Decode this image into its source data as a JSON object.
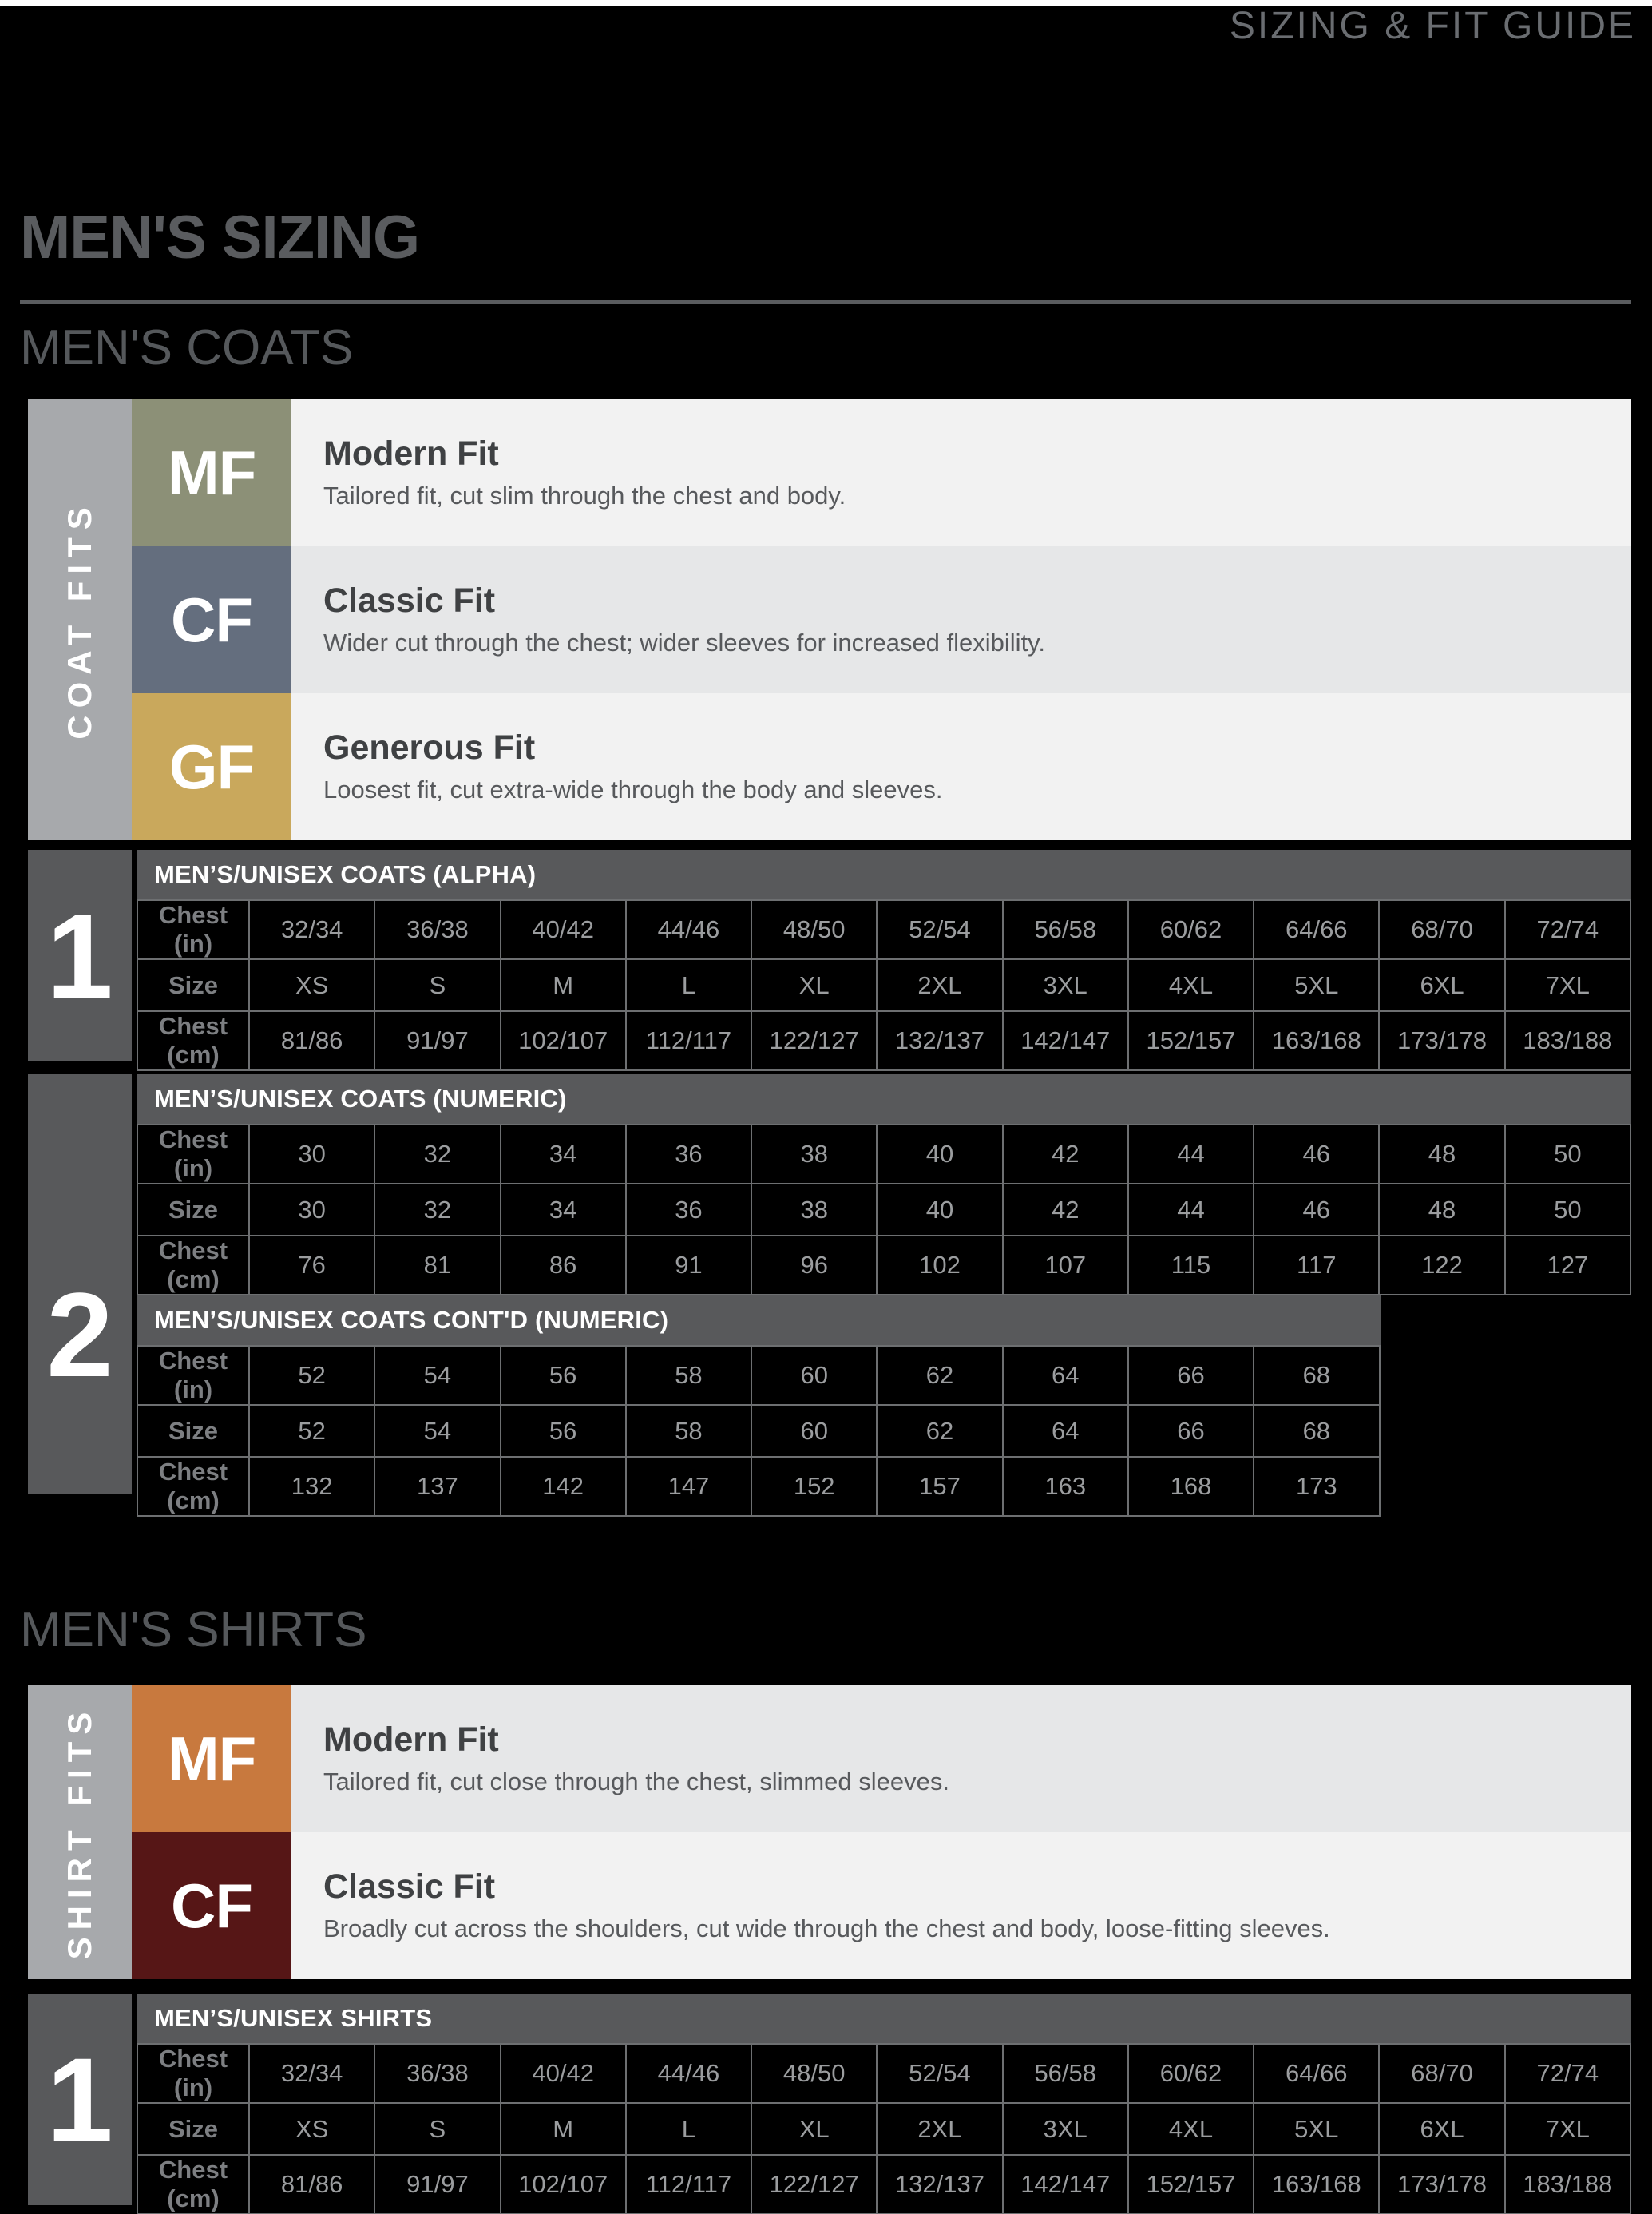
{
  "header": {
    "guide_title": "SIZING & FIT GUIDE"
  },
  "mens_sizing": {
    "section_title": "MEN'S SIZING",
    "coats": {
      "sub_title": "MEN'S COATS",
      "fits_spine_label": "COAT FITS",
      "fits": [
        {
          "code": "MF",
          "color": "#8c9077",
          "name": "Modern Fit",
          "desc": "Tailored fit, cut slim through the chest and body.",
          "row_bg": "#f2f2f2"
        },
        {
          "code": "CF",
          "color": "#646e7e",
          "name": "Classic Fit",
          "desc": "Wider cut through the chest; wider sleeves for increased flexibility.",
          "row_bg": "#e6e7e8"
        },
        {
          "code": "GF",
          "color": "#c9a85c",
          "name": "Generous Fit",
          "desc": "Loosest fit, cut extra-wide through the body and sleeves.",
          "row_bg": "#f2f2f2"
        }
      ],
      "table1": {
        "number": "1",
        "caption": "MEN’S/UNISEX COATS (ALPHA)",
        "rows": [
          {
            "label": "Chest (in)",
            "values": [
              "32/34",
              "36/38",
              "40/42",
              "44/46",
              "48/50",
              "52/54",
              "56/58",
              "60/62",
              "64/66",
              "68/70",
              "72/74"
            ]
          },
          {
            "label": "Size",
            "values": [
              "XS",
              "S",
              "M",
              "L",
              "XL",
              "2XL",
              "3XL",
              "4XL",
              "5XL",
              "6XL",
              "7XL"
            ]
          },
          {
            "label": "Chest (cm)",
            "values": [
              "81/86",
              "91/97",
              "102/107",
              "112/117",
              "122/127",
              "132/137",
              "142/147",
              "152/157",
              "163/168",
              "173/178",
              "183/188"
            ]
          }
        ]
      },
      "table2": {
        "number": "2",
        "caption_a": "MEN’S/UNISEX COATS (NUMERIC)",
        "rows_a": [
          {
            "label": "Chest (in)",
            "values": [
              "30",
              "32",
              "34",
              "36",
              "38",
              "40",
              "42",
              "44",
              "46",
              "48",
              "50"
            ]
          },
          {
            "label": "Size",
            "values": [
              "30",
              "32",
              "34",
              "36",
              "38",
              "40",
              "42",
              "44",
              "46",
              "48",
              "50"
            ]
          },
          {
            "label": "Chest (cm)",
            "values": [
              "76",
              "81",
              "86",
              "91",
              "96",
              "102",
              "107",
              "115",
              "117",
              "122",
              "127"
            ]
          }
        ],
        "caption_b": "MEN’S/UNISEX COATS CONT'D (NUMERIC)",
        "rows_b": [
          {
            "label": "Chest (in)",
            "values": [
              "52",
              "54",
              "56",
              "58",
              "60",
              "62",
              "64",
              "66",
              "68"
            ]
          },
          {
            "label": "Size",
            "values": [
              "52",
              "54",
              "56",
              "58",
              "60",
              "62",
              "64",
              "66",
              "68"
            ]
          },
          {
            "label": "Chest (cm)",
            "values": [
              "132",
              "137",
              "142",
              "147",
              "152",
              "157",
              "163",
              "168",
              "173"
            ]
          }
        ]
      }
    },
    "shirts": {
      "sub_title": "MEN'S SHIRTS",
      "fits_spine_label": "SHIRT FITS",
      "fits": [
        {
          "code": "MF",
          "color": "#c8793e",
          "name": "Modern Fit",
          "desc": "Tailored fit, cut close through the chest, slimmed sleeves.",
          "row_bg": "#e6e7e8"
        },
        {
          "code": "CF",
          "color": "#561616",
          "name": "Classic Fit",
          "desc": "Broadly cut across the shoulders, cut wide through the chest and body, loose-fitting sleeves.",
          "row_bg": "#f2f2f2"
        }
      ],
      "table1": {
        "number": "1",
        "caption": "MEN’S/UNISEX SHIRTS",
        "rows": [
          {
            "label": "Chest (in)",
            "values": [
              "32/34",
              "36/38",
              "40/42",
              "44/46",
              "48/50",
              "52/54",
              "56/58",
              "60/62",
              "64/66",
              "68/70",
              "72/74"
            ]
          },
          {
            "label": "Size",
            "values": [
              "XS",
              "S",
              "M",
              "L",
              "XL",
              "2XL",
              "3XL",
              "4XL",
              "5XL",
              "6XL",
              "7XL"
            ]
          },
          {
            "label": "Chest (cm)",
            "values": [
              "81/86",
              "91/97",
              "102/107",
              "112/117",
              "122/127",
              "132/137",
              "142/147",
              "152/157",
              "163/168",
              "173/178",
              "183/188"
            ]
          }
        ]
      }
    }
  }
}
